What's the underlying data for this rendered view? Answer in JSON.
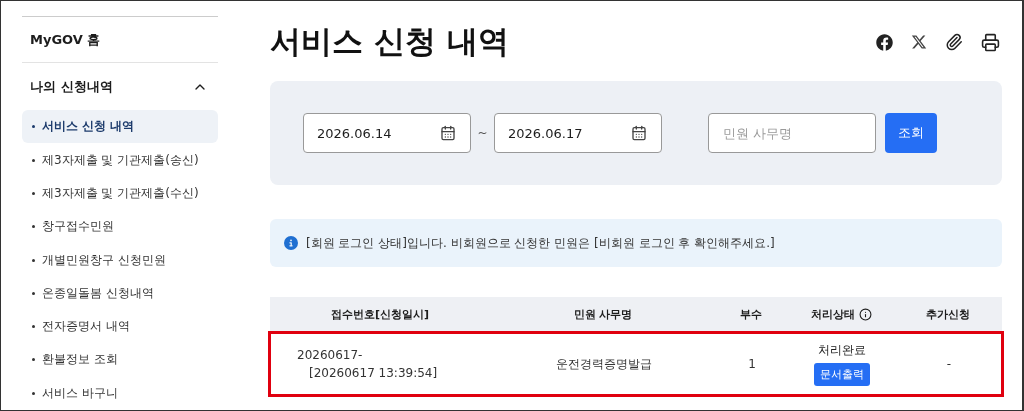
{
  "sidebar": {
    "home": "MyGOV 홈",
    "section": {
      "title": "나의 신청내역",
      "expanded": true
    },
    "items": [
      {
        "label": "서비스 신청 내역",
        "selected": true
      },
      {
        "label": "제3자제출 및 기관제출(송신)",
        "selected": false
      },
      {
        "label": "제3자제출 및 기관제출(수신)",
        "selected": false
      },
      {
        "label": "창구접수민원",
        "selected": false
      },
      {
        "label": "개별민원창구 신청민원",
        "selected": false
      },
      {
        "label": "온종일돌봄 신청내역",
        "selected": false
      },
      {
        "label": "전자증명서 내역",
        "selected": false
      },
      {
        "label": "환불정보 조회",
        "selected": false
      },
      {
        "label": "서비스 바구니",
        "selected": false
      }
    ]
  },
  "page_title": "서비스 신청 내역",
  "search": {
    "date_from": "2026.06.14",
    "separator": "~",
    "date_to": "2026.06.17",
    "placeholder": "민원 사무명",
    "button": "조회"
  },
  "notice": "[회원 로그인 상태]입니다. 비회원으로 신청한 민원은 [비회원 로그인 후 확인해주세요.]",
  "table": {
    "columns": [
      "접수번호[신청일시]",
      "민원 사무명",
      "부수",
      "처리상태",
      "추가신청"
    ],
    "rows": [
      {
        "receipt_number": "20260617-",
        "datetime": "[20260617 13:39:54]",
        "service": "운전경력증명발급",
        "copies": "1",
        "status": "처리완료",
        "action": "문서출력",
        "extra": "-",
        "highlighted": true
      }
    ]
  }
}
